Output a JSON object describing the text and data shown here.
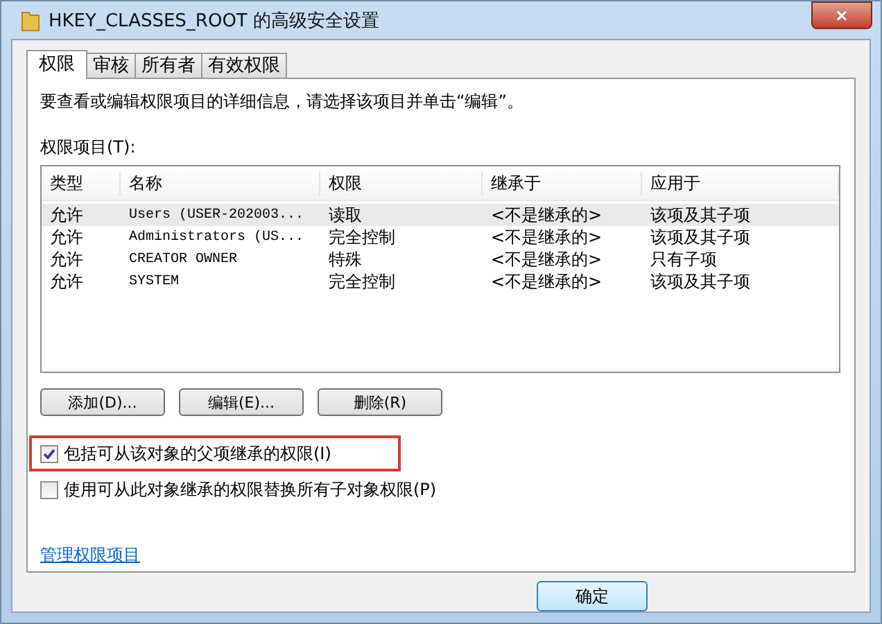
{
  "window": {
    "title": "HKEY_CLASSES_ROOT 的高级安全设置",
    "close": "×"
  },
  "tabs": [
    {
      "label": "权限",
      "selected": true
    },
    {
      "label": "审核",
      "selected": false
    },
    {
      "label": "所有者",
      "selected": false
    },
    {
      "label": "有效权限",
      "selected": false
    }
  ],
  "intro": "要查看或编辑权限项目的详细信息，请选择该项目并单击“编辑”。",
  "list_label": "权限项目(T):",
  "table": {
    "columns": [
      "类型",
      "名称",
      "权限",
      "继承于",
      "应用于"
    ],
    "rows": [
      {
        "cells": [
          "允许",
          "Users (USER-202003...",
          "读取",
          "<不是继承的>",
          "该项及其子项"
        ],
        "selected": true
      },
      {
        "cells": [
          "允许",
          "Administrators (US...",
          "完全控制",
          "<不是继承的>",
          "该项及其子项"
        ],
        "selected": false
      },
      {
        "cells": [
          "允许",
          "CREATOR OWNER",
          "特殊",
          "<不是继承的>",
          "只有子项"
        ],
        "selected": false
      },
      {
        "cells": [
          "允许",
          "SYSTEM",
          "完全控制",
          "<不是继承的>",
          "该项及其子项"
        ],
        "selected": false
      }
    ]
  },
  "buttons": [
    "添加(D)...",
    "编辑(E)...",
    "删除(R)"
  ],
  "options": [
    {
      "label": "包括可从该对象的父项继承的权限(I)",
      "checked": true,
      "highlighted": true
    },
    {
      "label": "使用可从此对象继承的权限替换所有子对象权限(P)",
      "checked": false,
      "highlighted": false
    }
  ],
  "link": "管理权限项目",
  "footer_buttons": [
    "确定"
  ]
}
